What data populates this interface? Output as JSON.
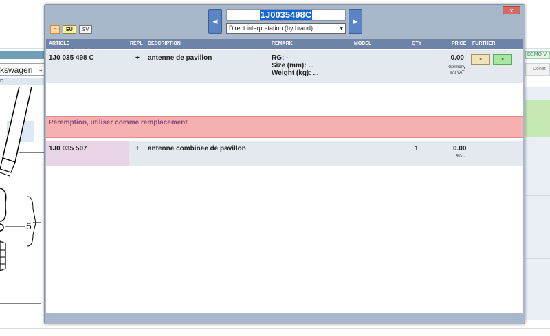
{
  "background": {
    "make_select": "kswagen",
    "left_label": "D",
    "diagram_callout": "5",
    "right_strip_text": "DEMO-V",
    "right_button": "Donat"
  },
  "modal": {
    "filters": [
      "=",
      "EU",
      "SV"
    ],
    "search_value": "1J0035498C",
    "interpretation": "Direct interpretation (by brand)",
    "close_label": "x",
    "columns": {
      "article": "ARTICLE",
      "repl": "REPL",
      "description": "DESCRIPTION",
      "remark": "REMARK",
      "model": "MODEL",
      "qty": "QTY",
      "price": "PRICE",
      "further": "FURTHER"
    },
    "rows": [
      {
        "article": "1J0 035 498 C",
        "repl": "+",
        "description": "antenne de pavillon",
        "remark_rg": "RG: -",
        "remark_size": "Size (mm): ...",
        "remark_weight": "Weight (kg): ...",
        "price": "0.00",
        "price_country": "Germany",
        "price_vat": "w/o VAT",
        "further_a": "»",
        "further_b": "»"
      }
    ],
    "warning": "Péremption, utiliser comme remplacement",
    "replacement": {
      "article": "1J0 035 507",
      "repl": "+",
      "description": "antenne combinee de pavillon",
      "qty": "1",
      "price": "0.00",
      "rg": "RG: -"
    }
  }
}
